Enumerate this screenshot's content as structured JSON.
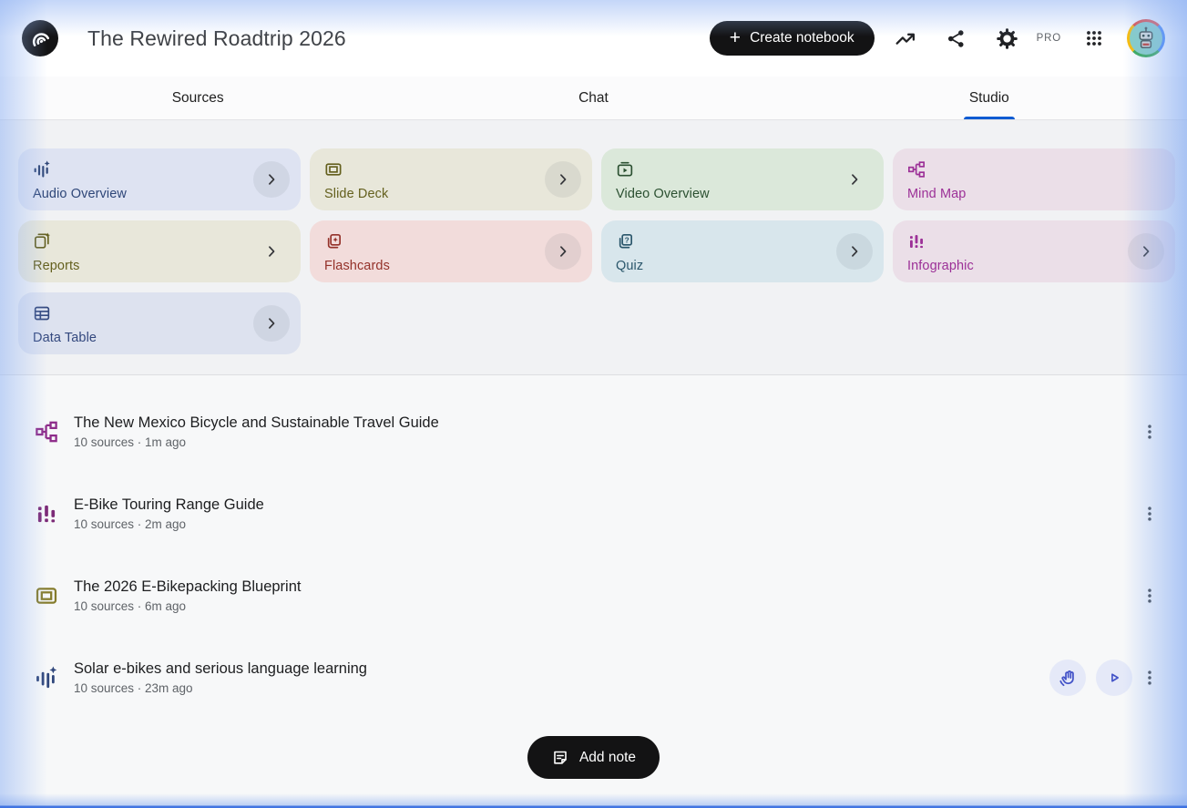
{
  "header": {
    "title": "The Rewired Roadtrip 2026",
    "create_notebook": {
      "label": "Create notebook",
      "plus": "+"
    },
    "pro_badge": "PRO",
    "icons": [
      "notebooklm-logo",
      "trending-up",
      "share",
      "settings-gear",
      "apps-grid",
      "account-avatar"
    ]
  },
  "tabs": [
    {
      "label": "Sources",
      "active": false
    },
    {
      "label": "Chat",
      "active": false
    },
    {
      "label": "Studio",
      "active": true
    }
  ],
  "studio_tools": [
    {
      "label": "Audio Overview",
      "icon": "audio-waveform-sparkle-icon",
      "bg": "#dee3f2",
      "fg": "#2e4678",
      "chevron": "circle"
    },
    {
      "label": "Slide Deck",
      "icon": "slide-frame-icon",
      "bg": "#e8e7da",
      "fg": "#64601e",
      "chevron": "circle"
    },
    {
      "label": "Video Overview",
      "icon": "video-play-icon",
      "bg": "#dbe8da",
      "fg": "#2b5031",
      "chevron": "plain"
    },
    {
      "label": "Mind Map",
      "icon": "mind-map-icon",
      "bg": "#ebdfe8",
      "fg": "#9c3097",
      "chevron": "none"
    },
    {
      "label": "Reports",
      "icon": "report-sparkle-icon",
      "bg": "#e8e7da",
      "fg": "#64601e",
      "chevron": "plain"
    },
    {
      "label": "Flashcards",
      "icon": "flashcards-star-icon",
      "bg": "#f2dcdb",
      "fg": "#943129",
      "chevron": "circle"
    },
    {
      "label": "Quiz",
      "icon": "quiz-cards-icon",
      "bg": "#d8e6ec",
      "fg": "#2a566b",
      "chevron": "circle"
    },
    {
      "label": "Infographic",
      "icon": "bar-chart-icon",
      "bg": "#ebdfe8",
      "fg": "#9c3097",
      "chevron": "circle"
    },
    {
      "label": "Data Table",
      "icon": "data-table-icon",
      "bg": "#dde2ef",
      "fg": "#33487e",
      "chevron": "circle"
    }
  ],
  "artifacts": [
    {
      "title": "The New Mexico Bicycle and Sustainable Travel Guide",
      "meta": "10 sources · 1m ago",
      "icon": "mind-map-icon"
    },
    {
      "title": "E-Bike Touring Range Guide",
      "meta": "10 sources · 2m ago",
      "icon": "bar-chart-icon"
    },
    {
      "title": "The 2026 E-Bikepacking Blueprint",
      "meta": "10 sources · 6m ago",
      "icon": "slide-frame-icon"
    },
    {
      "title": "Solar e-bikes and serious language learning",
      "meta": "10 sources · 23m ago",
      "icon": "audio-waveform-sparkle-icon",
      "actions": [
        "interactive-mode",
        "play"
      ]
    }
  ],
  "add_note": {
    "label": "Add note"
  },
  "colors": {
    "accent_blue": "#0f5bd2",
    "pill_black": "#131314",
    "edge_glow": "#8aafee"
  }
}
